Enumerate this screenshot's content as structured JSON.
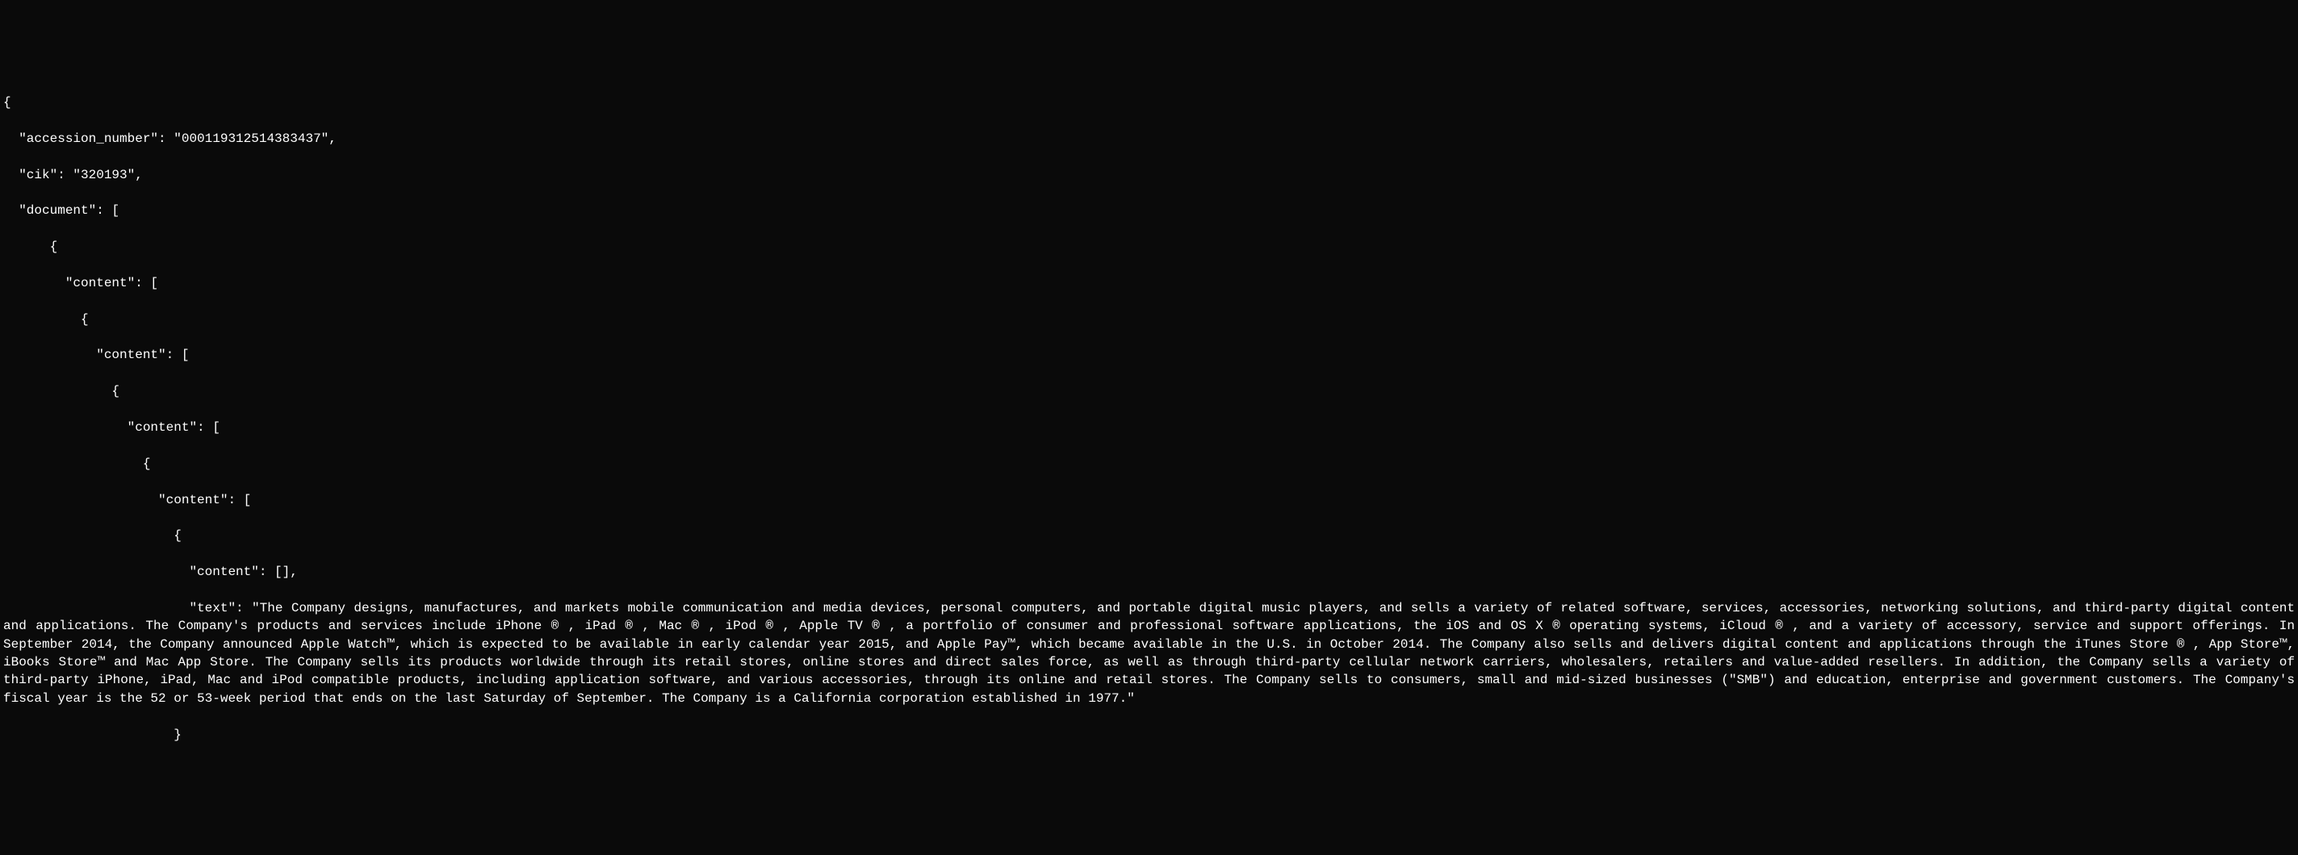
{
  "json_display": {
    "line1": "{",
    "line2": "\"accession_number\": \"000119312514383437\",",
    "line3": "\"cik\": \"320193\",",
    "line4": "\"document\": [",
    "line5": "{",
    "line6": "\"content\": [",
    "line7": "{",
    "line8": "\"content\": [",
    "line9": "{",
    "line10": "\"content\": [",
    "line11": "{",
    "line12": "\"content\": [",
    "line13": "{",
    "line14": "\"content\": [],",
    "line15_prefix": "\"text\": \"",
    "line15_text": "The Company designs, manufactures, and markets mobile communication and media devices, personal computers, and portable digital music players, and sells a variety of related software, services, accessories, networking solutions, and third-party digital content and applications. The Company's products and services include iPhone ® , iPad ® , Mac ® , iPod ® , Apple TV ® , a portfolio of consumer and professional software applications, the iOS and OS X ® operating systems, iCloud ® , and a variety of accessory, service and support offerings. In September 2014, the Company announced Apple Watch™, which is expected to be available in early calendar year 2015, and Apple Pay™, which became available in the U.S. in October 2014. The Company also sells and delivers digital content and applications through the iTunes Store ® , App Store™, iBooks Store™ and Mac App Store. The Company sells its products worldwide through its retail stores, online stores and direct sales force, as well as through third-party cellular network carriers, wholesalers, retailers and value-added resellers. In addition, the Company sells a variety of third-party iPhone, iPad, Mac and iPod compatible products, including application software, and various accessories, through its online and retail stores. The Company sells to consumers, small and mid-sized businesses (\"SMB\") and education, enterprise and government customers. The Company's fiscal year is the 52 or 53-week period that ends on the last Saturday of September. The Company is a California corporation established in 1977.\"",
    "line16": "}"
  }
}
